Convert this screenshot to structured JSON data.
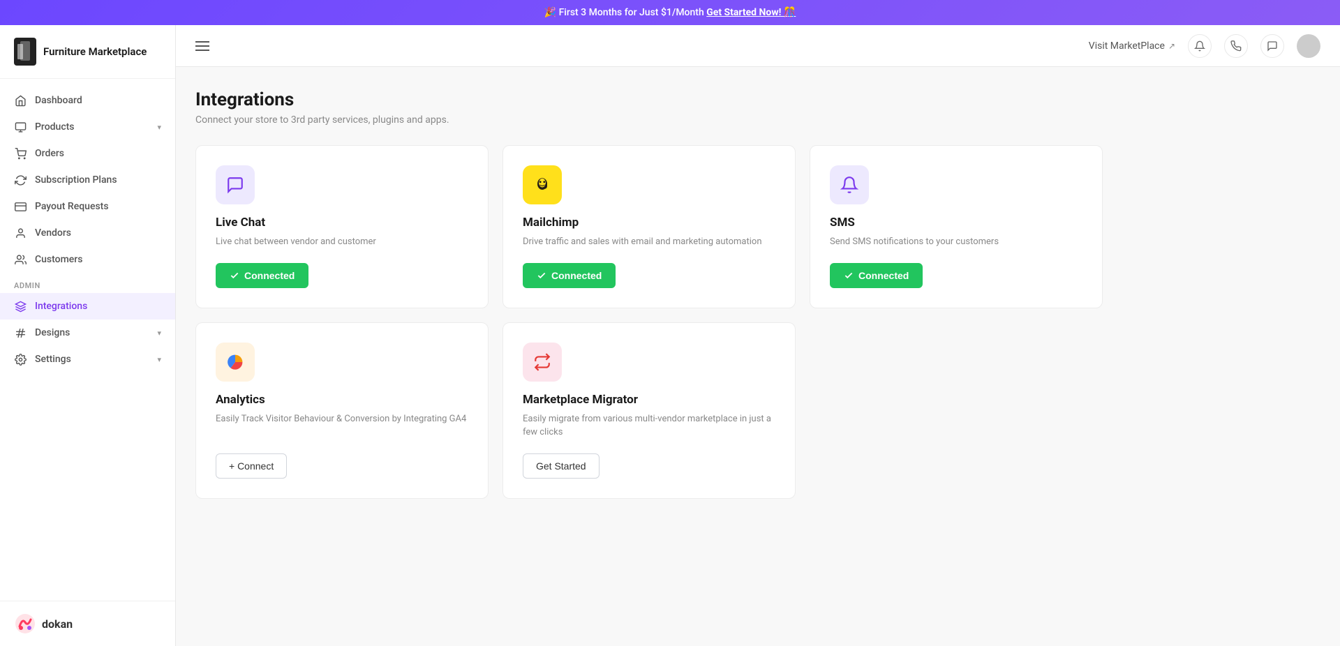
{
  "banner": {
    "text": "🎉 First 3 Months for Just $1/Month",
    "cta": "Get Started Now! 🎊"
  },
  "sidebar": {
    "brand": "Furniture Marketplace",
    "nav_items": [
      {
        "id": "dashboard",
        "label": "Dashboard",
        "icon": "home"
      },
      {
        "id": "products",
        "label": "Products",
        "icon": "tag",
        "has_chevron": true
      },
      {
        "id": "orders",
        "label": "Orders",
        "icon": "cart"
      },
      {
        "id": "subscription-plans",
        "label": "Subscription Plans",
        "icon": "refresh"
      },
      {
        "id": "payout-requests",
        "label": "Payout Requests",
        "icon": "credit-card"
      },
      {
        "id": "vendors",
        "label": "Vendors",
        "icon": "person"
      },
      {
        "id": "customers",
        "label": "Customers",
        "icon": "people"
      }
    ],
    "admin_label": "ADMIN",
    "admin_items": [
      {
        "id": "integrations",
        "label": "Integrations",
        "icon": "layers",
        "active": true
      },
      {
        "id": "designs",
        "label": "Designs",
        "icon": "hashtag",
        "has_chevron": true
      },
      {
        "id": "settings",
        "label": "Settings",
        "icon": "gear",
        "has_chevron": true
      }
    ],
    "footer_brand": "dokan"
  },
  "topbar": {
    "visit_marketplace": "Visit MarketPlace"
  },
  "page": {
    "title": "Integrations",
    "subtitle": "Connect your store to 3rd party services, plugins and apps."
  },
  "integrations": [
    {
      "id": "live-chat",
      "name": "Live Chat",
      "description": "Live chat between vendor and customer",
      "icon_type": "chat",
      "icon_color": "purple",
      "status": "connected",
      "btn_label": "Connected"
    },
    {
      "id": "mailchimp",
      "name": "Mailchimp",
      "description": "Drive traffic and sales with email and marketing automation",
      "icon_type": "mailchimp",
      "icon_color": "yellow",
      "status": "connected",
      "btn_label": "Connected"
    },
    {
      "id": "sms",
      "name": "SMS",
      "description": "Send SMS notifications to your customers",
      "icon_type": "bell",
      "icon_color": "lavender",
      "status": "connected",
      "btn_label": "Connected"
    },
    {
      "id": "analytics",
      "name": "Analytics",
      "description": "Easily Track Visitor Behaviour & Conversion by Integrating GA4",
      "icon_type": "analytics",
      "icon_color": "orange",
      "status": "connect",
      "btn_label": "+ Connect"
    },
    {
      "id": "marketplace-migrator",
      "name": "Marketplace Migrator",
      "description": "Easily migrate from various multi-vendor marketplace in just a few clicks",
      "icon_type": "transfer",
      "icon_color": "pink",
      "status": "get-started",
      "btn_label": "Get Started"
    }
  ]
}
